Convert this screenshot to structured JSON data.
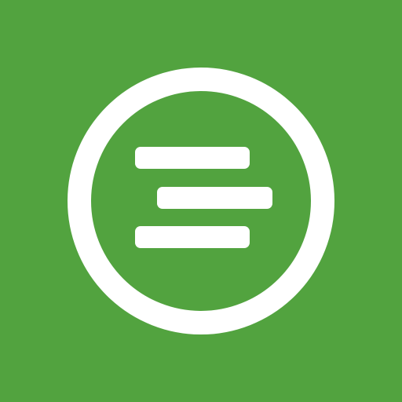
{
  "app_icon": {
    "icon": "lines-in-circle-icon",
    "colors": {
      "background": "#52a33f",
      "foreground": "#ffffff"
    }
  }
}
